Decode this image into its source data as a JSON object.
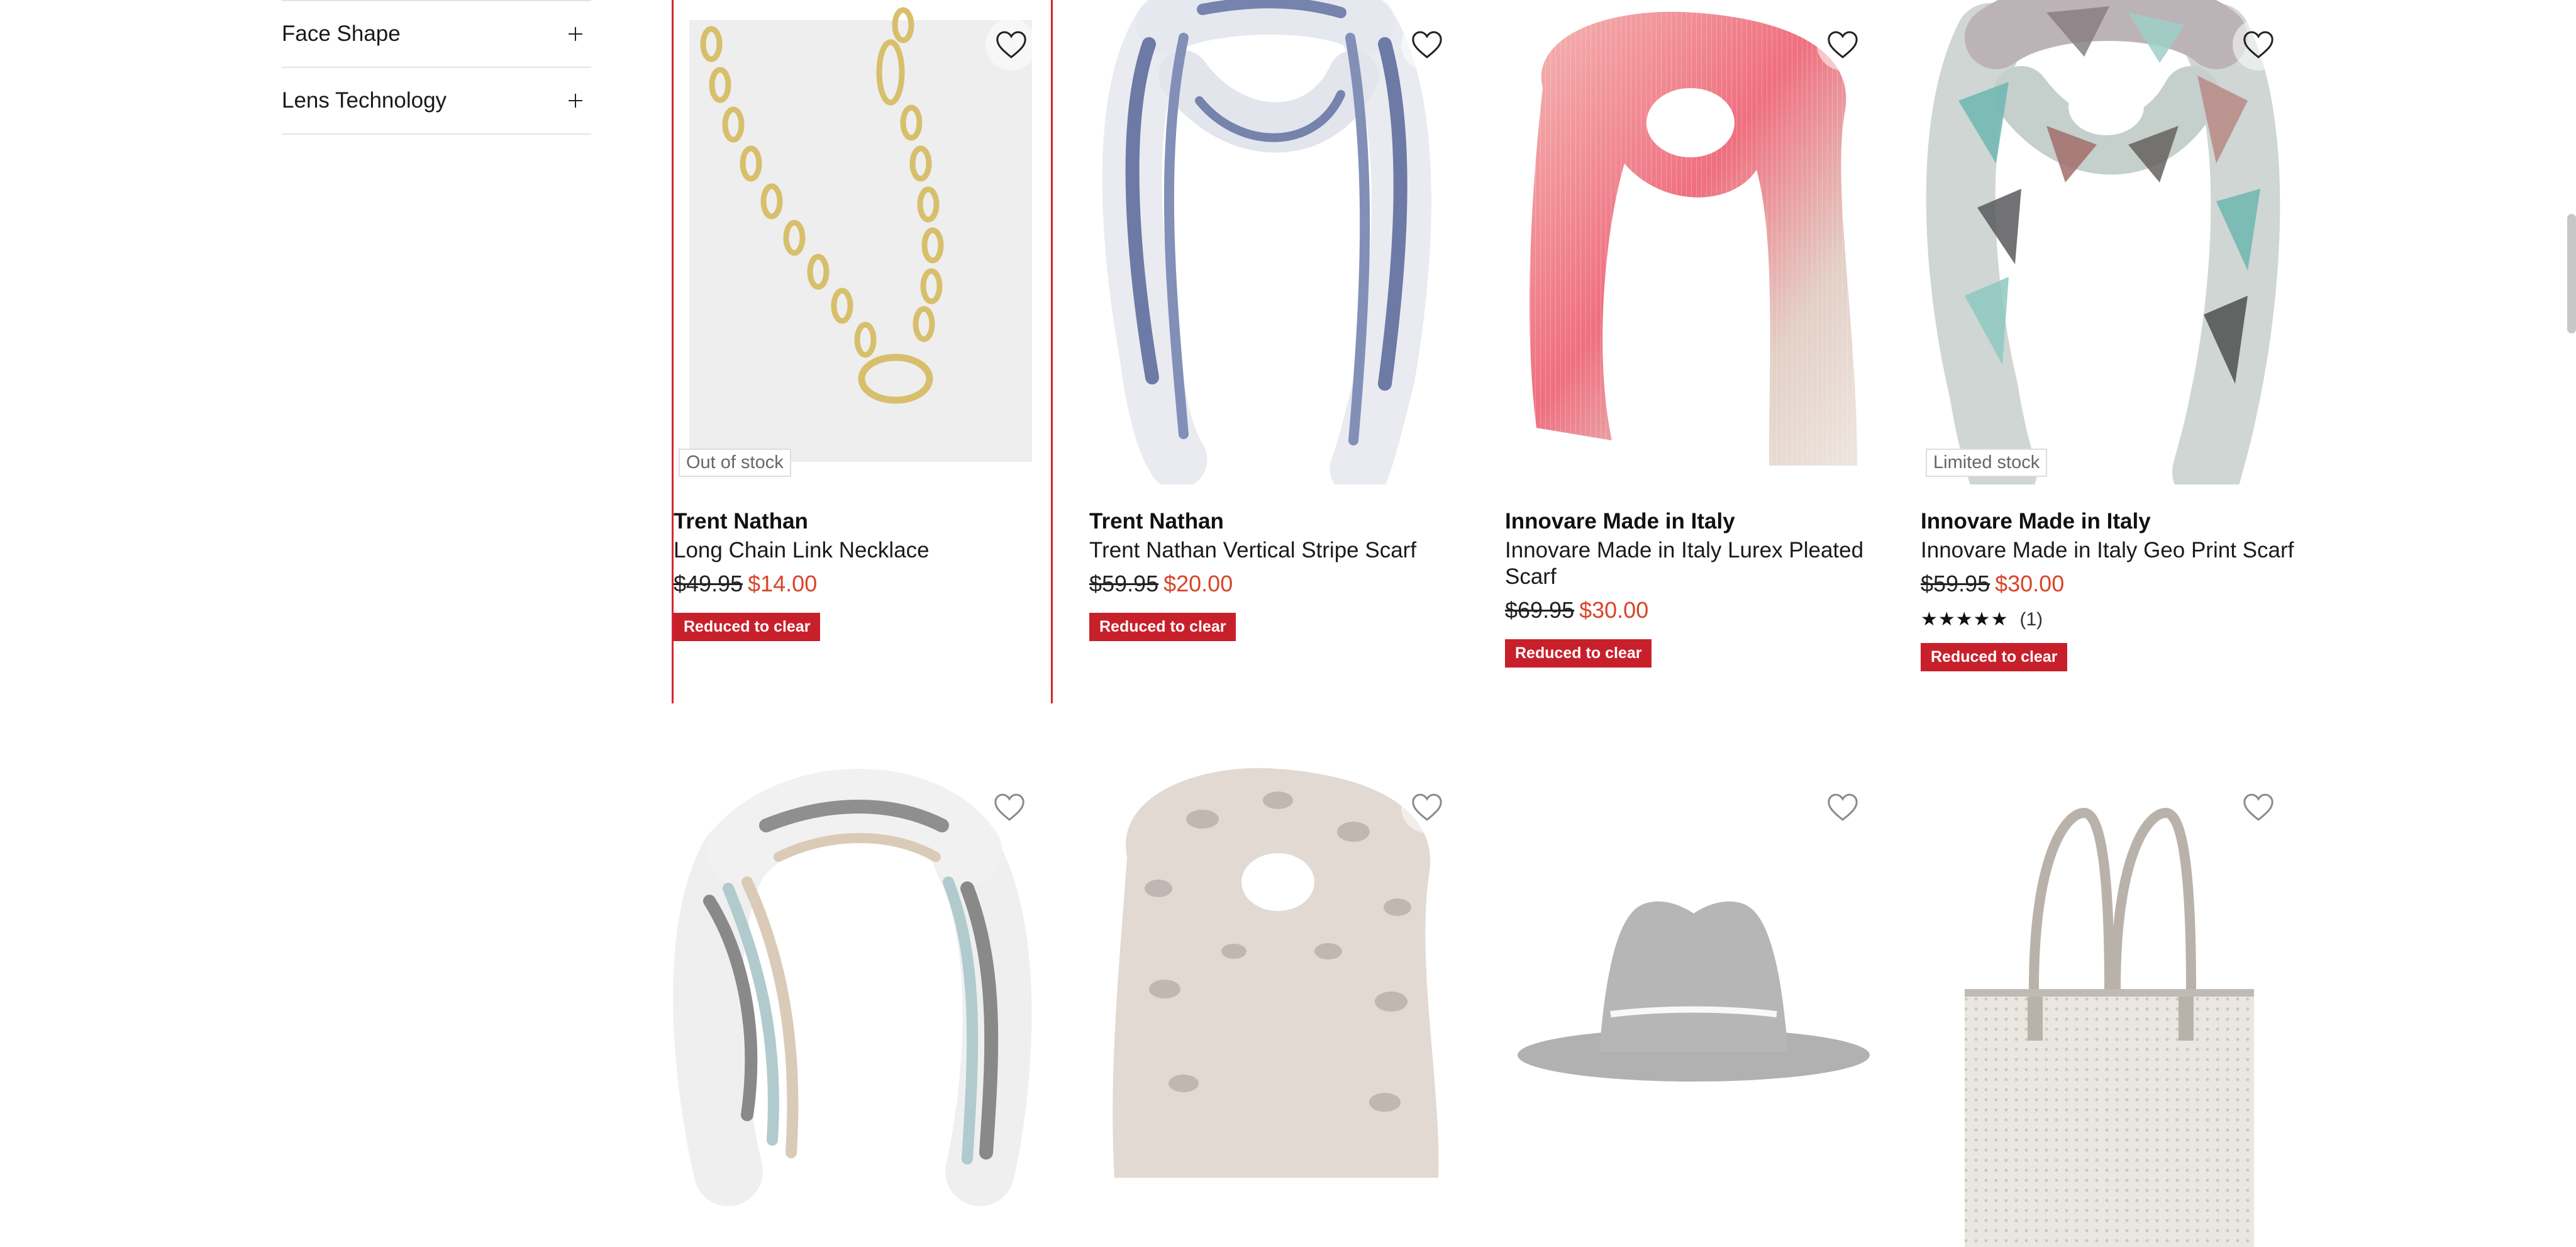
{
  "filters": [
    {
      "label": "Face Shape"
    },
    {
      "label": "Lens Technology"
    }
  ],
  "products": [
    {
      "brand": "Trent Nathan",
      "name": "Long Chain Link Necklace",
      "was": "$49.95",
      "now": "$14.00",
      "badge": "Out of stock",
      "tag": "Reduced to clear",
      "image": "chain-necklace-image"
    },
    {
      "brand": "Trent Nathan",
      "name": "Trent Nathan Vertical Stripe Scarf",
      "was": "$59.95",
      "now": "$20.00",
      "tag": "Reduced to clear",
      "image": "striped-scarf-image"
    },
    {
      "brand": "Innovare Made in Italy",
      "name": "Innovare Made in Italy Lurex Pleated Scarf",
      "was": "$69.95",
      "now": "$30.00",
      "tag": "Reduced to clear",
      "image": "pink-pleated-scarf-image"
    },
    {
      "brand": "Innovare Made in Italy",
      "name": "Innovare Made in Italy Geo Print Scarf",
      "was": "$59.95",
      "now": "$30.00",
      "badge": "Limited stock",
      "rating": {
        "stars": "★★★★★",
        "count": "(1)",
        "value": 5
      },
      "tag": "Reduced to clear",
      "image": "geo-print-scarf-image"
    }
  ],
  "second_row_images": [
    "striped-wrap-scarf-image",
    "leopard-scarf-image",
    "grey-fedora-hat-image",
    "woven-tote-bag-image"
  ],
  "colors": {
    "sale_price": "#d9442a",
    "clearance_tag": "#c8202b",
    "focus_outline": "#d9232e"
  }
}
